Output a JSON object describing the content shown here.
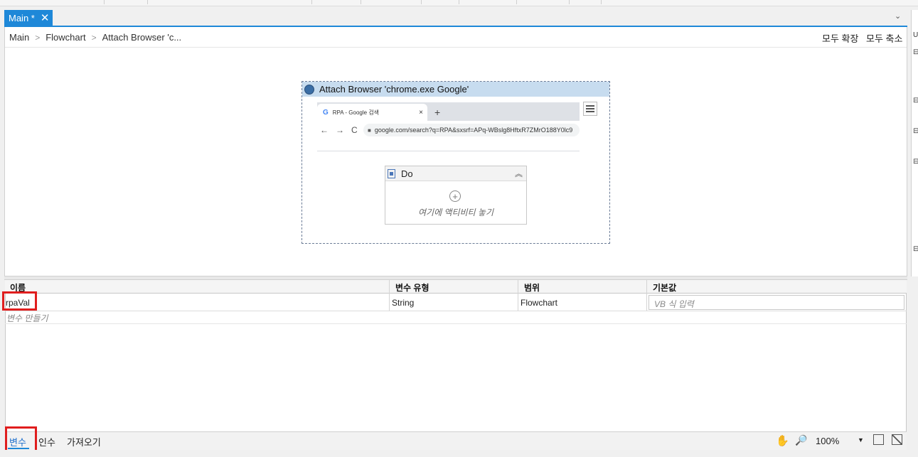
{
  "tab": {
    "title": "Main *",
    "close": "✕",
    "dropdown": "⌄"
  },
  "breadcrumb": [
    "Main",
    "Flowchart",
    "Attach Browser 'c..."
  ],
  "toolbar": {
    "expand_all": "모두 확장",
    "collapse_all": "모두 축소"
  },
  "attach_browser": {
    "title": "Attach Browser 'chrome.exe  Google'",
    "browser_tab_title": "RPA - Google 검색",
    "browser_tab_close": "×",
    "browser_new_tab": "+",
    "nav_back": "←",
    "nav_forward": "→",
    "nav_reload": "C",
    "url": "google.com/search?q=RPA&sxsrf=APq-WBslg8HftxR7ZMrO188Y0lc9"
  },
  "do_sequence": {
    "title": "Do",
    "drop_hint": "여기에 액티비티 놓기",
    "plus": "+",
    "collapse": "︽"
  },
  "variables": {
    "columns": [
      "이름",
      "변수 유형",
      "범위",
      "기본값"
    ],
    "rows": [
      {
        "name": "rpaVal",
        "type": "String",
        "scope": "Flowchart"
      }
    ],
    "default_placeholder": "VB 식 입력",
    "create_label": "변수 만들기"
  },
  "bottom_tabs": {
    "variables": "변수",
    "arguments": "인수",
    "imports": "가져오기"
  },
  "zoom": {
    "level": "100%",
    "caret": "▼",
    "hand": "✋",
    "magnifier": "🔎"
  },
  "right_panel_marks": [
    "U",
    "⊟",
    "⊟",
    "⊟",
    "⊟",
    "⊟"
  ]
}
